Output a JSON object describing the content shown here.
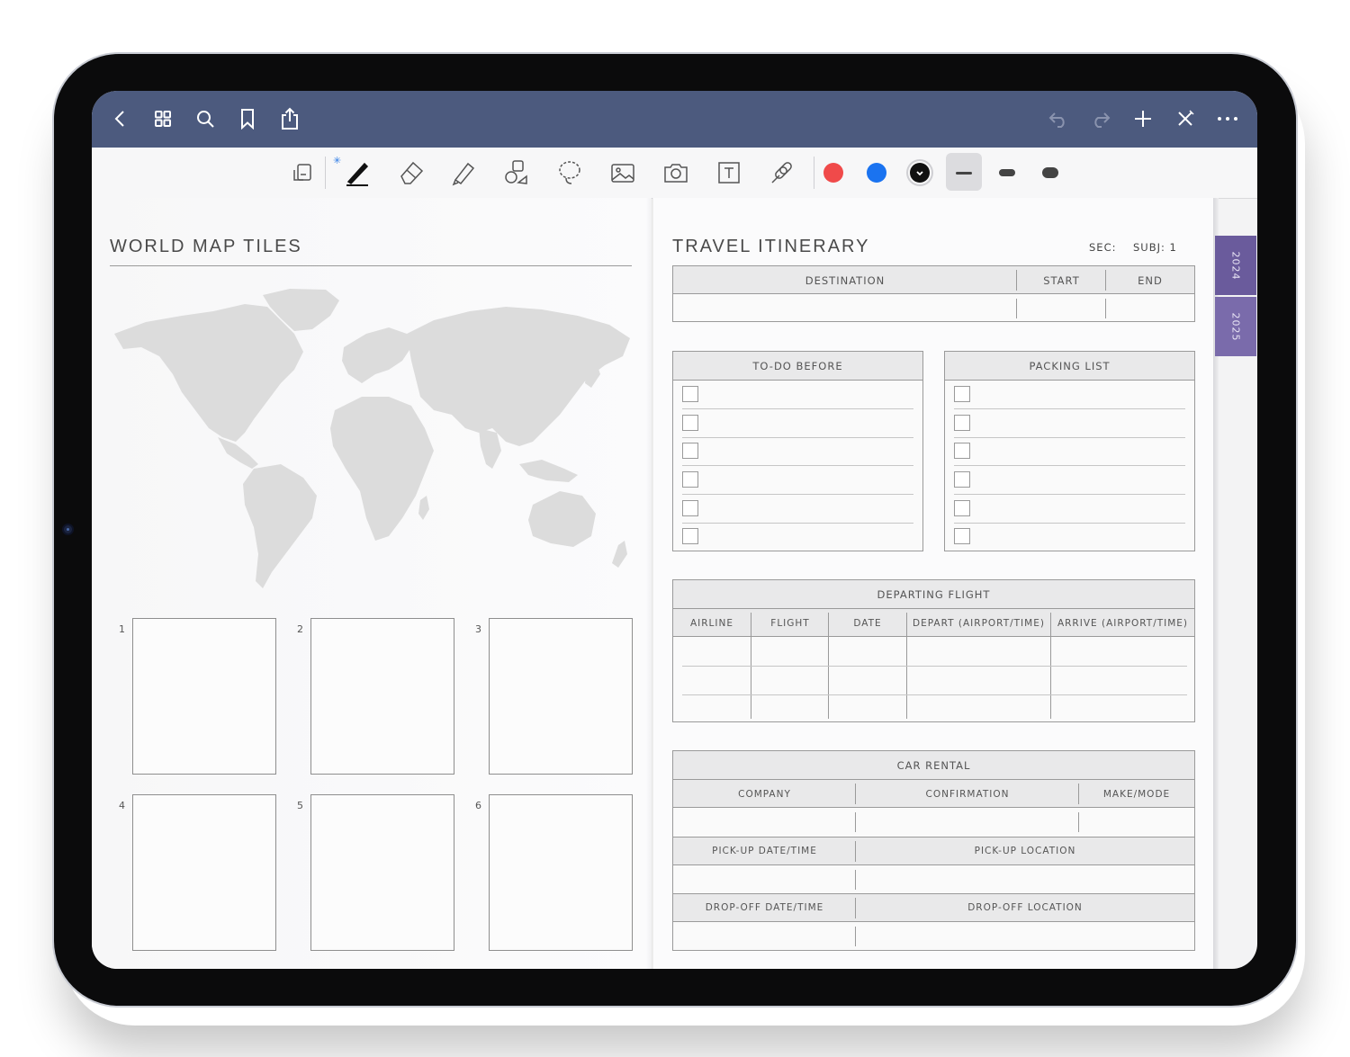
{
  "toolbar_top": {
    "left_icons": [
      "back-icon",
      "grid-icon",
      "search-icon",
      "bookmark-icon",
      "share-icon"
    ],
    "right_icons": [
      "undo-icon",
      "redo-icon",
      "plus-icon",
      "close-icon",
      "more-icon"
    ]
  },
  "tools": {
    "bluetooth_symbol": "✳",
    "items": [
      "page-switch-icon",
      "pen-icon",
      "eraser-icon",
      "highlighter-icon",
      "shapes-icon",
      "lasso-icon",
      "image-icon",
      "camera-icon",
      "text-icon",
      "link-icon"
    ],
    "colors": [
      "#f04a4a",
      "#1a73f0",
      "#111111"
    ],
    "strokes": [
      "thin",
      "medium",
      "thick"
    ]
  },
  "tabs": [
    "2024",
    "2025"
  ],
  "left": {
    "title": "WORLD MAP TILES",
    "tiles": [
      "1",
      "2",
      "3",
      "4",
      "5",
      "6"
    ]
  },
  "right": {
    "title": "TRAVEL ITINERARY",
    "sec_label": "SEC:",
    "subj_label": "SUBJ: 1",
    "dest": {
      "destination": "DESTINATION",
      "start": "START",
      "end": "END"
    },
    "todo_title": "TO-DO BEFORE",
    "packing_title": "PACKING LIST",
    "departing": {
      "title": "DEPARTING FLIGHT",
      "columns": [
        "AIRLINE",
        "FLIGHT",
        "DATE",
        "DEPART (AIRPORT/TIME)",
        "ARRIVE (AIRPORT/TIME)"
      ]
    },
    "car": {
      "title": "CAR RENTAL",
      "company": "COMPANY",
      "confirmation": "CONFIRMATION",
      "make": "MAKE/MODE",
      "pickup_dt": "PICK-UP DATE/TIME",
      "pickup_loc": "PICK-UP LOCATION",
      "dropoff_dt": "DROP-OFF DATE/TIME",
      "dropoff_loc": "DROP-OFF LOCATION"
    }
  }
}
